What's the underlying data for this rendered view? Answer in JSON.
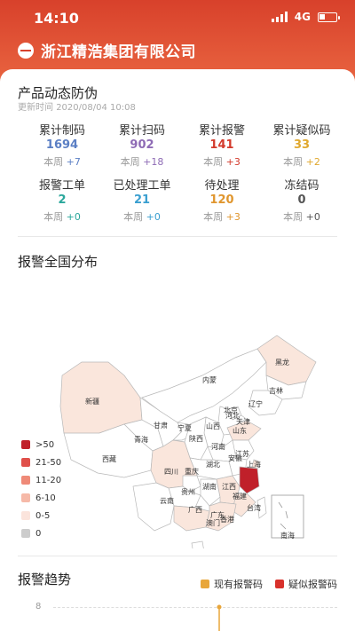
{
  "status_bar": {
    "time": "14:10",
    "network": "4G"
  },
  "header": {
    "company": "浙江精浩集团有限公司"
  },
  "anti_fake": {
    "title": "产品动态防伪",
    "update_label": "更新时间",
    "update_time": "2020/08/04  10:08",
    "week_prefix": "本周",
    "stats": [
      {
        "label": "累计制码",
        "value": "1694",
        "week": "+7",
        "color": "#5b7fc4"
      },
      {
        "label": "累计扫码",
        "value": "902",
        "week": "+18",
        "color": "#8e6bb5"
      },
      {
        "label": "累计报警",
        "value": "141",
        "week": "+3",
        "color": "#d33a2c"
      },
      {
        "label": "累计疑似码",
        "value": "33",
        "week": "+2",
        "color": "#e0a82e"
      },
      {
        "label": "报警工单",
        "value": "2",
        "week": "+0",
        "color": "#2aa79b"
      },
      {
        "label": "已处理工单",
        "value": "21",
        "week": "+0",
        "color": "#3a9fd0"
      },
      {
        "label": "待处理",
        "value": "120",
        "week": "+3",
        "color": "#e0962e"
      },
      {
        "label": "冻结码",
        "value": "0",
        "week": "+0",
        "color": "#555555"
      }
    ]
  },
  "map": {
    "title": "报警全国分布",
    "legend": [
      {
        "label": ">50",
        "color": "#c0202a"
      },
      {
        "label": "21-50",
        "color": "#e0504a"
      },
      {
        "label": "11-20",
        "color": "#ef8a78"
      },
      {
        "label": "6-10",
        "color": "#f6b9a8"
      },
      {
        "label": "0-5",
        "color": "#fbe4dc"
      },
      {
        "label": "0",
        "color": "#cccccc"
      }
    ],
    "provinces": {
      "heilongjiang": "黑龙",
      "jilin": "吉林",
      "liaoning": "辽宁",
      "neimeng": "内蒙",
      "beijing": "北京",
      "hebei": "河北",
      "tianjin": "天津",
      "shandong": "山东",
      "shanxi": "山西",
      "henan": "河南",
      "jiangsu": "江苏",
      "anhui": "安徽",
      "shanghai": "上海",
      "hubei": "湖北",
      "zhejiang": "浙",
      "xinjiang": "新疆",
      "gansu": "甘肃",
      "ningxia": "宁夏",
      "shaanxi": "陕西",
      "qinghai": "青海",
      "xizang": "西藏",
      "sichuan": "四川",
      "chongqing": "重庆",
      "guizhou": "贵州",
      "hunan": "湖南",
      "jiangxi": "江西",
      "fujian": "福建",
      "yunnan": "云南",
      "guangxi": "广西",
      "guangdong": "广东",
      "taiwan": "台湾",
      "aomen": "澳门",
      "xianggang": "香港",
      "hainan": "海南",
      "nanhai": "南海"
    }
  },
  "trend": {
    "title": "报警趋势",
    "legend": [
      {
        "label": "现有报警码",
        "color": "#e8a63a"
      },
      {
        "label": "疑似报警码",
        "color": "#d8312b"
      }
    ],
    "y_tick": "8"
  }
}
